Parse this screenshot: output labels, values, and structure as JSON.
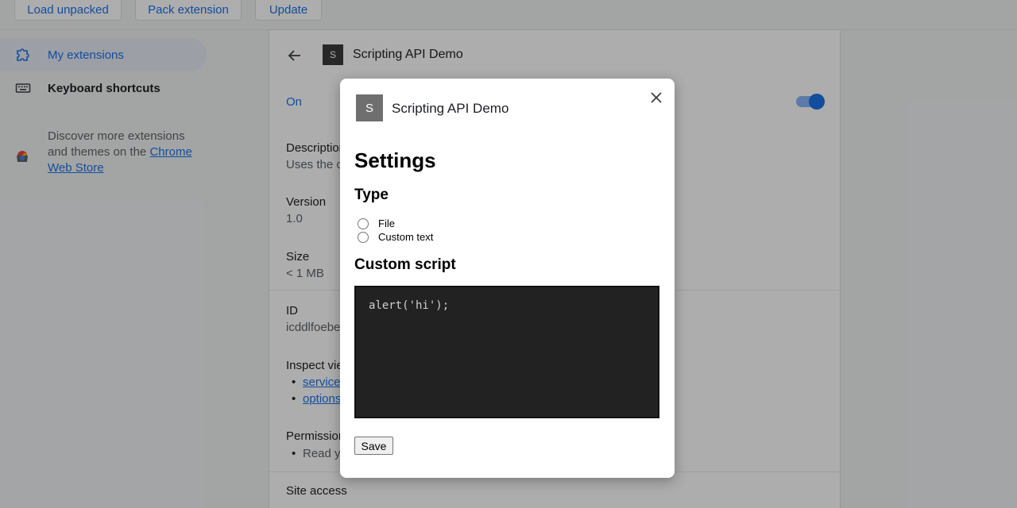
{
  "toolbar": {
    "load_unpacked": "Load unpacked",
    "pack_extension": "Pack extension",
    "update": "Update"
  },
  "sidebar": {
    "items": [
      {
        "label": "My extensions",
        "icon": "puzzle-icon",
        "active": true
      },
      {
        "label": "Keyboard shortcuts",
        "icon": "keyboard-icon",
        "active": false
      }
    ],
    "discover_text": "Discover more extensions and themes on the ",
    "store_link": "Chrome Web Store"
  },
  "details": {
    "name": "Scripting API Demo",
    "icon_letter": "S",
    "on_label": "On",
    "description_label": "Description",
    "description_value": "Uses the c",
    "version_label": "Version",
    "version_value": "1.0",
    "size_label": "Size",
    "size_value": "< 1 MB",
    "id_label": "ID",
    "id_value": "icddlfoebe",
    "inspect_label": "Inspect vie",
    "inspect_links": [
      "service",
      "options"
    ],
    "permissions_label": "Permission",
    "permissions_items": [
      "Read yo"
    ],
    "site_access_label": "Site access"
  },
  "dialog": {
    "icon_letter": "S",
    "title": "Scripting API Demo",
    "settings_heading": "Settings",
    "type_heading": "Type",
    "radio_options": [
      "File",
      "Custom text"
    ],
    "custom_script_heading": "Custom script",
    "script_value": "alert('hi');",
    "save_label": "Save"
  },
  "colors": {
    "accent": "#1a73e8",
    "toggle_track": "#8ab4f8",
    "code_bg": "#222222"
  }
}
